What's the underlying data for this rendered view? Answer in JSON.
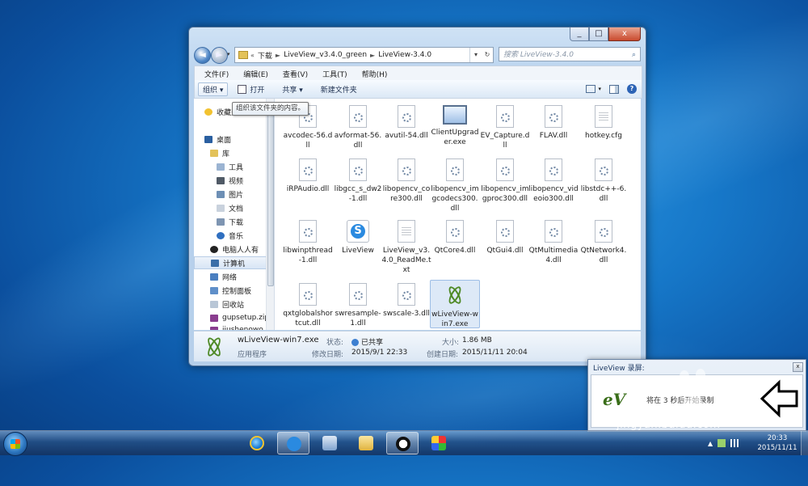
{
  "window": {
    "caption_buttons": [
      "_",
      "□",
      "x"
    ],
    "nav": {
      "back": "◄",
      "forward": "►",
      "dropdown": "▾"
    },
    "address": {
      "prefix": "«",
      "segments": [
        "下载",
        "LiveView_v3.4.0_green",
        "LiveView-3.4.0"
      ],
      "sep": "►",
      "dd": "▾",
      "refresh": "↻"
    },
    "search": {
      "placeholder": "搜索 LiveView-3.4.0",
      "icon": "⌕"
    },
    "menubar": [
      "文件(F)",
      "编辑(E)",
      "查看(V)",
      "工具(T)",
      "帮助(H)"
    ],
    "commands": {
      "organize": "组织 ▾",
      "open": "打开",
      "share": "共享 ▾",
      "new_folder": "新建文件夹",
      "help": "?"
    },
    "tooltip": "组织该文件夹的内容。",
    "nav_pane": [
      {
        "label": "收藏夹",
        "icon": "star-icon"
      },
      {
        "label": "桌面",
        "icon": "desktop-icon"
      },
      {
        "label": "库",
        "icon": "library-icon"
      },
      {
        "label": "工具",
        "icon": "folder-icon"
      },
      {
        "label": "视频",
        "icon": "video-icon"
      },
      {
        "label": "图片",
        "icon": "picture-icon"
      },
      {
        "label": "文档",
        "icon": "document-icon"
      },
      {
        "label": "下载",
        "icon": "download-icon"
      },
      {
        "label": "音乐",
        "icon": "music-icon"
      },
      {
        "label": "电脑人人有",
        "icon": "panda-icon"
      },
      {
        "label": "计算机",
        "icon": "computer-icon"
      },
      {
        "label": "网络",
        "icon": "network-icon"
      },
      {
        "label": "控制面板",
        "icon": "control-panel-icon"
      },
      {
        "label": "回收站",
        "icon": "recycle-bin-icon"
      },
      {
        "label": "gupsetup.zip",
        "icon": "archive-icon"
      },
      {
        "label": "jiushenowo_setu",
        "icon": "archive-icon"
      }
    ],
    "files": [
      {
        "name": "avcodec-56.dll",
        "type": "dll"
      },
      {
        "name": "avformat-56.dll",
        "type": "dll"
      },
      {
        "name": "avutil-54.dll",
        "type": "dll"
      },
      {
        "name": "ClientUpgrader.exe",
        "type": "app"
      },
      {
        "name": "EV_Capture.dll",
        "type": "dll"
      },
      {
        "name": "FLAV.dll",
        "type": "dll"
      },
      {
        "name": "hotkey.cfg",
        "type": "txt"
      },
      {
        "name": "iRPAudio.dll",
        "type": "dll"
      },
      {
        "name": "libgcc_s_dw2-1.dll",
        "type": "dll"
      },
      {
        "name": "libopencv_core300.dll",
        "type": "dll"
      },
      {
        "name": "libopencv_imgcodecs300.dll",
        "type": "dll"
      },
      {
        "name": "libopencv_imgproc300.dll",
        "type": "dll"
      },
      {
        "name": "libopencv_videoio300.dll",
        "type": "dll"
      },
      {
        "name": "libstdc++-6.dll",
        "type": "dll"
      },
      {
        "name": "libwinpthread-1.dll",
        "type": "dll"
      },
      {
        "name": "LiveView",
        "type": "s"
      },
      {
        "name": "LiveView_v3.4.0_ReadMe.txt",
        "type": "txt"
      },
      {
        "name": "QtCore4.dll",
        "type": "dll"
      },
      {
        "name": "QtGui4.dll",
        "type": "dll"
      },
      {
        "name": "QtMultimedia4.dll",
        "type": "dll"
      },
      {
        "name": "QtNetwork4.dll",
        "type": "dll"
      },
      {
        "name": "qxtglobalshortcut.dll",
        "type": "dll"
      },
      {
        "name": "swresample-1.dll",
        "type": "dll"
      },
      {
        "name": "swscale-3.dll",
        "type": "dll"
      },
      {
        "name": "wLiveView-win7.exe",
        "type": "atom"
      }
    ],
    "details": {
      "name": "wLiveView-win7.exe",
      "type": "应用程序",
      "state_label": "状态:",
      "state_value": "已共享",
      "modified_label": "修改日期:",
      "modified_value": "2015/9/1 22:33",
      "size_label": "大小:",
      "size_value": "1.86 MB",
      "created_label": "创建日期:",
      "created_value": "2015/11/11 20:04"
    }
  },
  "popup": {
    "title": "LiveView 录屏:",
    "close": "x",
    "text": "将在 3 秒后开始录制",
    "logo": "eV"
  },
  "watermark": {
    "text": "经验",
    "url": "jingyan.baidu.com"
  },
  "taskbar": {
    "clock_time": "20:33",
    "clock_date": "2015/11/11",
    "tray_up": "▲"
  }
}
